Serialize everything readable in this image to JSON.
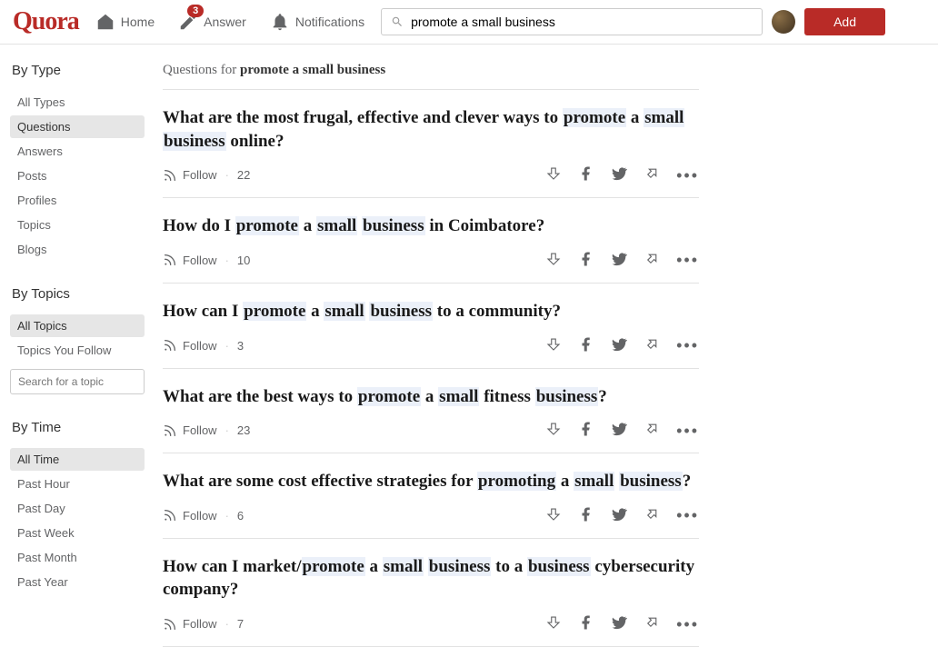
{
  "header": {
    "logo": "Quora",
    "nav": {
      "home": "Home",
      "answer": "Answer",
      "answer_badge": "3",
      "notifications": "Notifications"
    },
    "search_value": "promote a small business",
    "add_button": "Add"
  },
  "sidebar": {
    "by_type": {
      "heading": "By Type",
      "items": [
        "All Types",
        "Questions",
        "Answers",
        "Posts",
        "Profiles",
        "Topics",
        "Blogs"
      ],
      "active_index": 1
    },
    "by_topics": {
      "heading": "By Topics",
      "items": [
        "All Topics",
        "Topics You Follow"
      ],
      "active_index": 0,
      "search_placeholder": "Search for a topic"
    },
    "by_time": {
      "heading": "By Time",
      "items": [
        "All Time",
        "Past Hour",
        "Past Day",
        "Past Week",
        "Past Month",
        "Past Year"
      ],
      "active_index": 0
    }
  },
  "results": {
    "header_prefix": "Questions for ",
    "header_query": "promote a small business",
    "follow_label": "Follow",
    "questions": [
      {
        "title_parts": [
          {
            "t": "What are the most frugal, effective and clever ways to "
          },
          {
            "t": "promote",
            "hl": true
          },
          {
            "t": " a "
          },
          {
            "t": "small",
            "hl": true
          },
          {
            "t": " "
          },
          {
            "t": "business",
            "hl": true
          },
          {
            "t": " online?"
          }
        ],
        "follow_count": "22"
      },
      {
        "title_parts": [
          {
            "t": "How do I "
          },
          {
            "t": "promote",
            "hl": true
          },
          {
            "t": " a "
          },
          {
            "t": "small",
            "hl": true
          },
          {
            "t": " "
          },
          {
            "t": "business",
            "hl": true
          },
          {
            "t": " in Coimbatore?"
          }
        ],
        "follow_count": "10"
      },
      {
        "title_parts": [
          {
            "t": "How can I "
          },
          {
            "t": "promote",
            "hl": true
          },
          {
            "t": " a "
          },
          {
            "t": "small",
            "hl": true
          },
          {
            "t": " "
          },
          {
            "t": "business",
            "hl": true
          },
          {
            "t": " to a community?"
          }
        ],
        "follow_count": "3"
      },
      {
        "title_parts": [
          {
            "t": "What are the best ways to "
          },
          {
            "t": "promote",
            "hl": true
          },
          {
            "t": " a "
          },
          {
            "t": "small",
            "hl": true
          },
          {
            "t": " fitness "
          },
          {
            "t": "business",
            "hl": true
          },
          {
            "t": "?"
          }
        ],
        "follow_count": "23"
      },
      {
        "title_parts": [
          {
            "t": "What are some cost effective strategies for "
          },
          {
            "t": "promoting",
            "hl": true
          },
          {
            "t": " a "
          },
          {
            "t": "small",
            "hl": true
          },
          {
            "t": " "
          },
          {
            "t": "business",
            "hl": true
          },
          {
            "t": "?"
          }
        ],
        "follow_count": "6"
      },
      {
        "title_parts": [
          {
            "t": "How can I market/"
          },
          {
            "t": "promote",
            "hl": true
          },
          {
            "t": " a "
          },
          {
            "t": "small",
            "hl": true
          },
          {
            "t": " "
          },
          {
            "t": "business",
            "hl": true
          },
          {
            "t": " to a "
          },
          {
            "t": "business",
            "hl": true
          },
          {
            "t": " cybersecurity company?"
          }
        ],
        "follow_count": "7"
      }
    ]
  }
}
